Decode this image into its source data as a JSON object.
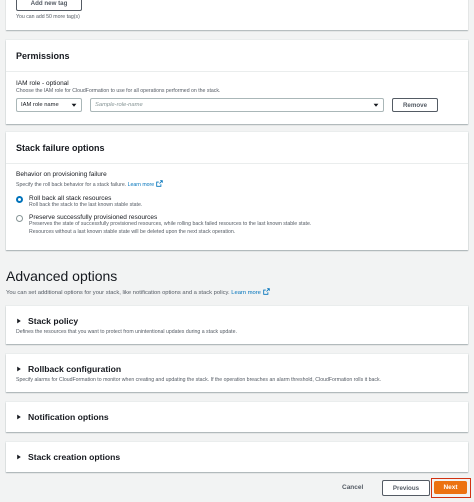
{
  "tags": {
    "add_button": "Add new tag",
    "hint": "You can add 50 more tag(s)"
  },
  "permissions": {
    "title": "Permissions",
    "iam_label": "IAM role - optional",
    "iam_desc": "Choose the IAM role for CloudFormation to use for all operations performed on the stack.",
    "iam_type_value": "IAM role name",
    "role_placeholder": "Sample-role-name",
    "remove_button": "Remove"
  },
  "failure": {
    "title": "Stack failure options",
    "behavior_label": "Behavior on provisioning failure",
    "behavior_desc": "Specify the roll back behavior for a stack failure.",
    "learn_more": "Learn more",
    "options": [
      {
        "label": "Roll back all stack resources",
        "desc": "Roll back the stack to the last known stable state.",
        "checked": true
      },
      {
        "label": "Preserve successfully provisioned resources",
        "desc1": "Preserves the state of successfully provisioned resources, while rolling back failed resources to the last known stable state.",
        "desc2": "Resources without a last known stable state will be deleted upon the next stack operation.",
        "checked": false
      }
    ]
  },
  "advanced": {
    "title": "Advanced options",
    "desc": "You can set additional options for your stack, like notification options and a stack policy.",
    "learn_more": "Learn more",
    "sections": [
      {
        "title": "Stack policy",
        "desc": "Defines the resources that you want to protect from unintentional updates during a stack update."
      },
      {
        "title": "Rollback configuration",
        "desc": "Specify alarms for CloudFormation to monitor when creating and updating the stack. If the operation breaches an alarm threshold, CloudFormation rolls it back."
      },
      {
        "title": "Notification options",
        "desc": ""
      },
      {
        "title": "Stack creation options",
        "desc": ""
      }
    ]
  },
  "footer": {
    "cancel": "Cancel",
    "previous": "Previous",
    "next": "Next"
  },
  "colors": {
    "link": "#0073bb",
    "primary": "#ec7211",
    "highlight_border": "#d13212"
  }
}
